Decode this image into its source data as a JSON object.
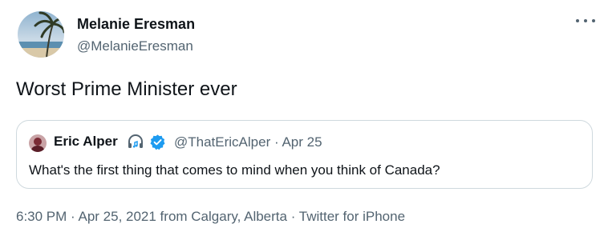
{
  "author": {
    "name": "Melanie Eresman",
    "handle": "@MelanieEresman"
  },
  "tweet": {
    "text": "Worst Prime Minister ever"
  },
  "quoted_tweet": {
    "name": "Eric Alper",
    "handle": "@ThatEricAlper",
    "separator": "·",
    "date": "Apr 25",
    "text": "What's the first thing that comes to mind when you think of Canada?"
  },
  "footer": {
    "text": "6:30 PM · Apr 25, 2021 from Calgary, Alberta · Twitter for iPhone"
  },
  "icons": {
    "more": "more-horizontal-icon",
    "verified": "verified-badge-icon",
    "headphones": "headphones-icon"
  },
  "colors": {
    "text_primary": "#0f1419",
    "text_secondary": "#536471",
    "border": "#cfd9de",
    "verified_blue": "#1d9bf0"
  }
}
